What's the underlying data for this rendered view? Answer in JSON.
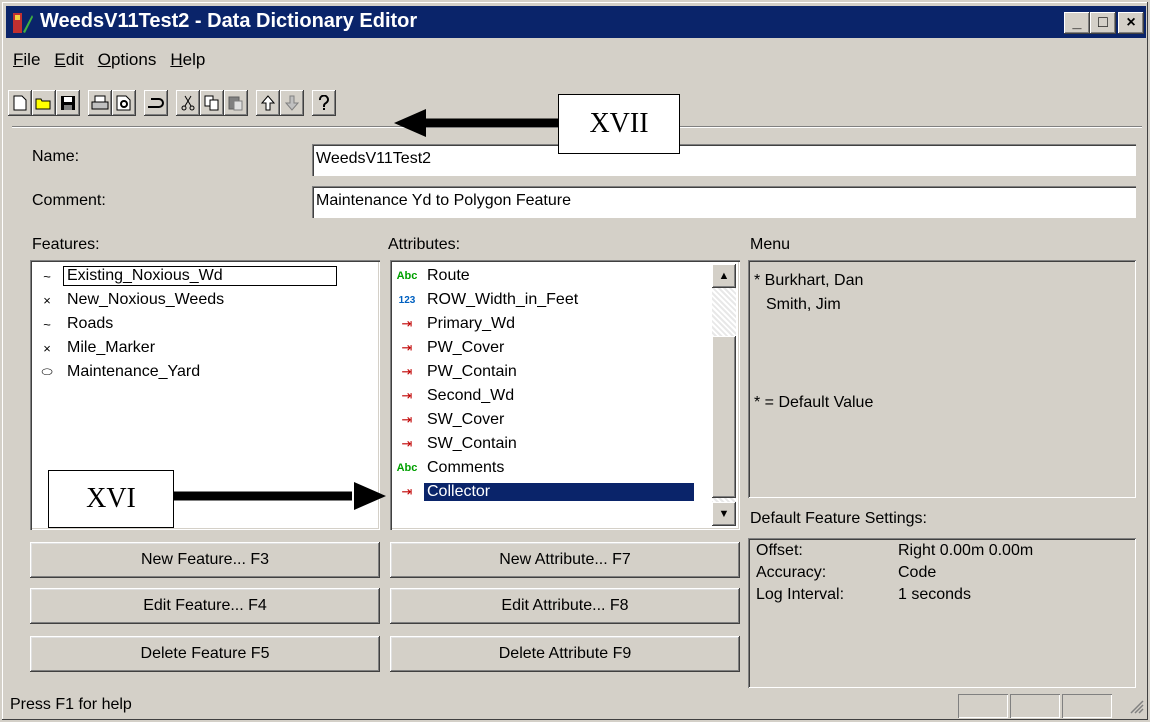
{
  "window": {
    "title": "WeedsV11Test2 - Data Dictionary Editor",
    "controls": {
      "minimize": "_",
      "maximize": "□",
      "close": "×"
    }
  },
  "menu": [
    {
      "label": "File",
      "mnemonic": "F"
    },
    {
      "label": "Edit",
      "mnemonic": "E"
    },
    {
      "label": "Options",
      "mnemonic": "O"
    },
    {
      "label": "Help",
      "mnemonic": "H"
    }
  ],
  "toolbar": {
    "icons": [
      "new-icon",
      "open-icon",
      "save-icon",
      "print-icon",
      "print-preview-icon",
      "undo-icon",
      "cut-icon",
      "copy-icon",
      "paste-icon",
      "move-up-icon",
      "move-down-icon",
      "help-icon"
    ]
  },
  "form": {
    "name_label": "Name:",
    "name_value": "WeedsV11Test2",
    "comment_label": "Comment:",
    "comment_value": "Maintenance Yd to Polygon Feature"
  },
  "features": {
    "label": "Features:",
    "items": [
      {
        "label": "Existing_Noxious_Wd",
        "icon": "line-feature-icon",
        "glyph": "~"
      },
      {
        "label": "New_Noxious_Weeds",
        "icon": "point-feature-icon",
        "glyph": "×"
      },
      {
        "label": "Roads",
        "icon": "line-feature-icon",
        "glyph": "~"
      },
      {
        "label": "Mile_Marker",
        "icon": "point-feature-icon",
        "glyph": "×"
      },
      {
        "label": "Maintenance_Yard",
        "icon": "area-feature-icon",
        "glyph": "⬭"
      }
    ]
  },
  "attributes": {
    "label": "Attributes:",
    "items": [
      {
        "label": "Route",
        "icon": "text-attribute-icon",
        "glyph": "Abc"
      },
      {
        "label": "ROW_Width_in_Feet",
        "icon": "numeric-attribute-icon",
        "glyph": "123"
      },
      {
        "label": "Primary_Wd",
        "icon": "menu-attribute-icon",
        "glyph": "⇥"
      },
      {
        "label": "PW_Cover",
        "icon": "menu-attribute-icon",
        "glyph": "⇥"
      },
      {
        "label": "PW_Contain",
        "icon": "menu-attribute-icon",
        "glyph": "⇥"
      },
      {
        "label": "Second_Wd",
        "icon": "menu-attribute-icon",
        "glyph": "⇥"
      },
      {
        "label": "SW_Cover",
        "icon": "menu-attribute-icon",
        "glyph": "⇥"
      },
      {
        "label": "SW_Contain",
        "icon": "menu-attribute-icon",
        "glyph": "⇥"
      },
      {
        "label": "Comments",
        "icon": "text-attribute-icon",
        "glyph": "Abc"
      },
      {
        "label": "Collector",
        "icon": "menu-attribute-icon",
        "glyph": "⇥"
      }
    ]
  },
  "menu_panel": {
    "label": "Menu",
    "line1": "* Burkhart, Dan",
    "line2": "Smith, Jim",
    "note": "* = Default Value"
  },
  "defaults": {
    "label": "Default Feature Settings:",
    "offset_label": "Offset:",
    "offset_value": "Right 0.00m 0.00m",
    "accuracy_label": "Accuracy:",
    "accuracy_value": "Code",
    "log_label": "Log Interval:",
    "log_value": "1 seconds"
  },
  "buttons": {
    "new_feature": "New Feature... F3",
    "edit_feature": "Edit Feature... F4",
    "delete_feature": "Delete Feature F5",
    "new_attribute": "New Attribute... F7",
    "edit_attribute": "Edit Attribute... F8",
    "delete_attribute": "Delete Attribute F9"
  },
  "status": {
    "text": "Press F1 for help"
  },
  "callouts": {
    "xvii": "XVII",
    "xvi": "XVI"
  },
  "colors": {
    "titlebar": "#0a246a",
    "selection": "#0a246a",
    "face": "#d4d0c8"
  }
}
